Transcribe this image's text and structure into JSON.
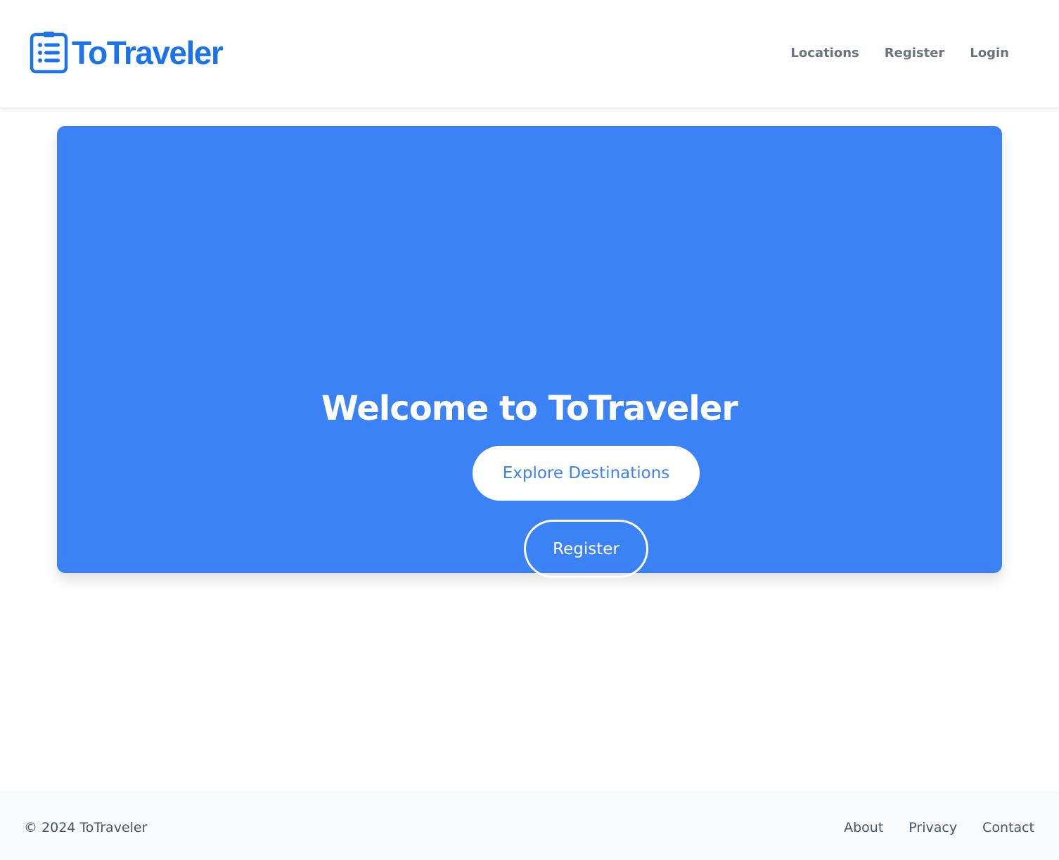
{
  "brand": {
    "name": "ToTraveler",
    "icon": "clipboard-list-icon",
    "color": "#1a73e8"
  },
  "nav": {
    "items": [
      {
        "label": "Locations"
      },
      {
        "label": "Register"
      },
      {
        "label": "Login"
      }
    ]
  },
  "hero": {
    "title": "Welcome to ToTraveler",
    "background_color": "#3b82f6",
    "primary_button": "Explore Destinations",
    "secondary_button": "Register"
  },
  "footer": {
    "copyright": "© 2024 ToTraveler",
    "links": [
      {
        "label": "About"
      },
      {
        "label": "Privacy"
      },
      {
        "label": "Contact"
      }
    ]
  }
}
